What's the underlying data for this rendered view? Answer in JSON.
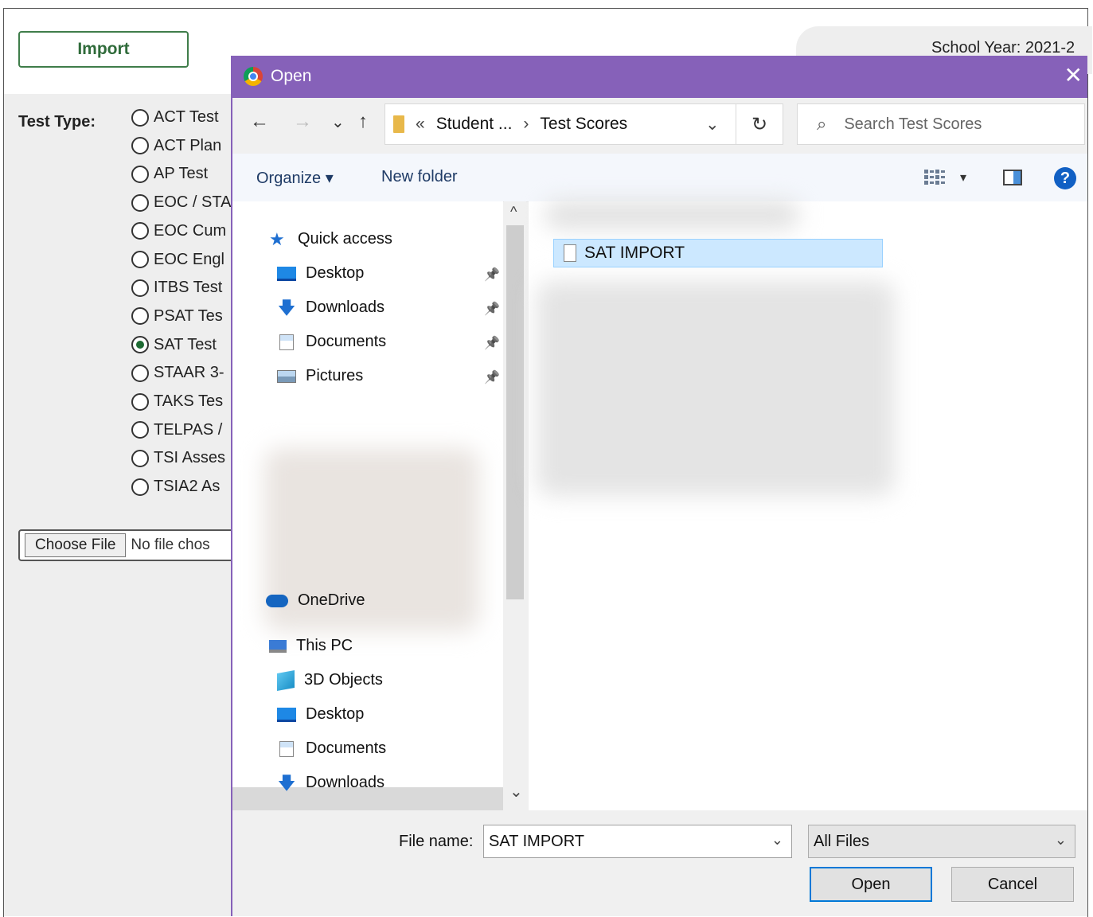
{
  "page": {
    "import_button": "Import",
    "school_year": "School Year: 2021-2",
    "test_type_label": "Test Type:",
    "test_types": [
      {
        "label": "ACT Test",
        "checked": false
      },
      {
        "label": "ACT Plan",
        "checked": false
      },
      {
        "label": "AP Test",
        "checked": false
      },
      {
        "label": "EOC / STA",
        "checked": false
      },
      {
        "label": "EOC Cum",
        "checked": false
      },
      {
        "label": "EOC Engl",
        "checked": false
      },
      {
        "label": "ITBS Test",
        "checked": false
      },
      {
        "label": "PSAT Tes",
        "checked": false
      },
      {
        "label": "SAT Test",
        "checked": true
      },
      {
        "label": "STAAR 3-",
        "checked": false
      },
      {
        "label": "TAKS Tes",
        "checked": false
      },
      {
        "label": "TELPAS /",
        "checked": false
      },
      {
        "label": "TSI Asses",
        "checked": false
      },
      {
        "label": "TSIA2 As",
        "checked": false
      }
    ],
    "choose_file": "Choose File",
    "no_file": "No file chos"
  },
  "dialog": {
    "title": "Open",
    "close": "✕",
    "nav": {
      "back": "←",
      "forward": "→",
      "recent": "⌄",
      "up": "↑"
    },
    "address": {
      "prefix": "«",
      "crumbs": [
        "Student ...",
        "Test Scores"
      ],
      "sep": "›",
      "dropdown": "⌄"
    },
    "refresh": "↻",
    "search_placeholder": "Search Test Scores",
    "search_icon": "⌕",
    "toolbar": {
      "organize": "Organize ▾",
      "new_folder": "New folder",
      "view_caret": "▾",
      "help": "?"
    },
    "nav_pane": {
      "quick_access": "Quick access",
      "quick_items": [
        {
          "label": "Desktop",
          "icon": "desktop-icon"
        },
        {
          "label": "Downloads",
          "icon": "downloads-icon"
        },
        {
          "label": "Documents",
          "icon": "documents-icon"
        },
        {
          "label": "Pictures",
          "icon": "pictures-icon"
        }
      ],
      "onedrive": "OneDrive",
      "this_pc": "This PC",
      "pc_items": [
        {
          "label": "3D Objects",
          "icon": "3d-objects-icon"
        },
        {
          "label": "Desktop",
          "icon": "desktop-icon"
        },
        {
          "label": "Documents",
          "icon": "documents-icon"
        },
        {
          "label": "Downloads",
          "icon": "downloads-icon"
        }
      ],
      "scroll_up": "^",
      "scroll_down": "⌄"
    },
    "files": [
      {
        "name": "SAT IMPORT",
        "selected": true
      }
    ],
    "file_name_label": "File name:",
    "file_name_value": "SAT IMPORT",
    "file_filter": "All Files",
    "open_button": "Open",
    "cancel_button": "Cancel"
  },
  "colors": {
    "titlebar": "#8661b9",
    "accent_blue": "#0078d7",
    "selection": "#cce8ff",
    "import_green": "#2f6b3a"
  }
}
